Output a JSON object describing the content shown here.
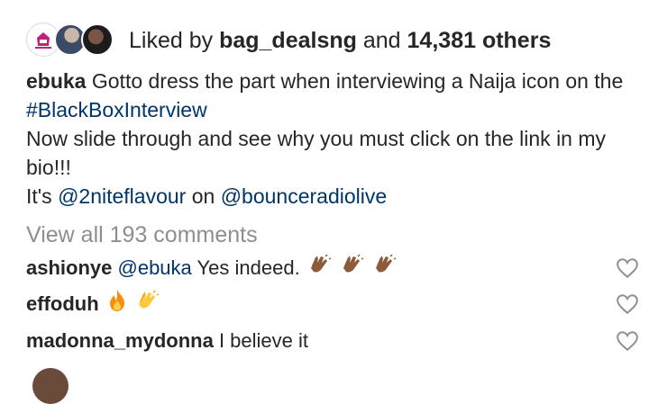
{
  "likes": {
    "prefix": "Liked by",
    "first_user": "bag_dealsng",
    "connector": "and",
    "others": "14,381 others",
    "avatar_icons": [
      "profile-logo-avatar",
      "user-avatar",
      "user-avatar"
    ]
  },
  "caption": {
    "author": "ebuka",
    "line1_text": "Gotto dress the part when interviewing a Naija icon on the",
    "hashtag": "#BlackBoxInterview",
    "line2": "Now slide through and see why you must click on the link in my bio!!!",
    "line3_prefix": "It's",
    "mention1": "@2niteflavour",
    "line3_mid": "on",
    "mention2": "@bounceradiolive"
  },
  "view_all": "View all 193 comments",
  "comments": [
    {
      "user": "ashionye",
      "mention": "@ebuka",
      "text": "Yes indeed.",
      "emojis": [
        "clapping-hands",
        "clapping-hands",
        "clapping-hands"
      ]
    },
    {
      "user": "effoduh",
      "text": "",
      "emojis": [
        "fire",
        "clapping-hands"
      ]
    },
    {
      "user": "madonna_mydonna",
      "text": "I believe it",
      "emojis": []
    }
  ],
  "colors": {
    "text": "#262626",
    "link": "#003569",
    "muted": "#8e8e8e",
    "heart_outline": "#8e8e8e"
  }
}
